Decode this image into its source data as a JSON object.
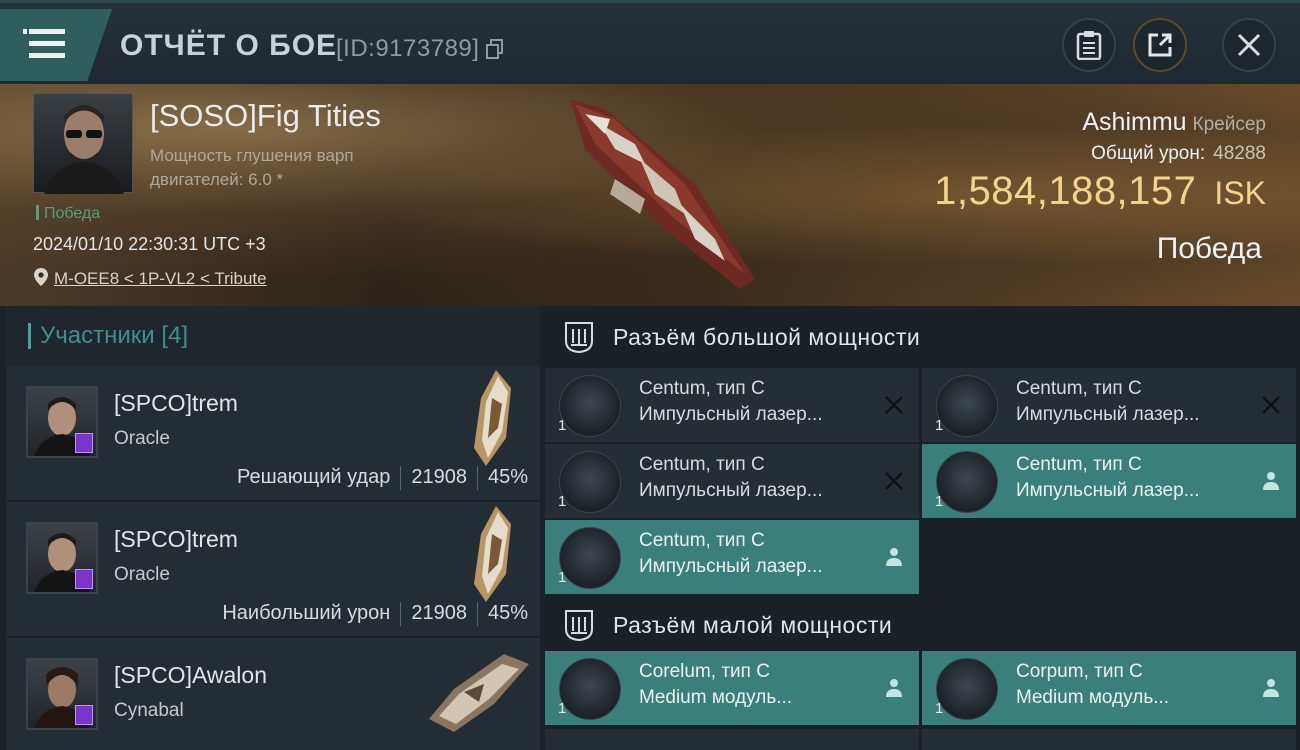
{
  "header": {
    "title": "ОТЧЁТ О БОЕ",
    "report_id": "[ID:9173789]"
  },
  "victim": {
    "name": "[SOSO]Fig Tities",
    "attribute": "Мощность глушения варп двигателей: 6.0 *",
    "result_tag": "Победа",
    "datetime": "2024/01/10 22:30:31 UTC +3",
    "location": "M-OEE8 < 1P-VL2 < Tribute",
    "ship_name": "Ashimmu",
    "ship_class": "Крейсер",
    "total_damage_label": "Общий урон:",
    "total_damage": "48288",
    "isk_value": "1,584,188,157",
    "isk_unit": "ISK",
    "result": "Победа"
  },
  "participants": {
    "label": "Участники",
    "count": "[4]",
    "rows": [
      {
        "name": "[SPCO]trem",
        "ship": "Oracle",
        "tag": "Решающий удар",
        "damage": "21908",
        "percent": "45%"
      },
      {
        "name": "[SPCO]trem",
        "ship": "Oracle",
        "tag": "Наибольший урон",
        "damage": "21908",
        "percent": "45%"
      },
      {
        "name": "[SPCO]Awalon",
        "ship": "Cynabal",
        "tag": "",
        "damage": "",
        "percent": ""
      }
    ]
  },
  "fitting": {
    "high_slot_label": "Разъём большой мощности",
    "low_slot_label": "Разъём малой мощности",
    "high_slots": [
      {
        "name": "Centum, тип C",
        "desc": "Импульсный лазер...",
        "qty": "1",
        "status": "destroyed"
      },
      {
        "name": "Centum, тип C",
        "desc": "Импульсный лазер...",
        "qty": "1",
        "status": "destroyed"
      },
      {
        "name": "Centum, тип C",
        "desc": "Импульсный лазер...",
        "qty": "1",
        "status": "destroyed"
      },
      {
        "name": "Centum, тип C",
        "desc": "Импульсный лазер...",
        "qty": "1",
        "status": "dropped"
      },
      {
        "name": "Centum, тип C",
        "desc": "Импульсный лазер...",
        "qty": "1",
        "status": "dropped"
      }
    ],
    "low_slots": [
      {
        "name": "Corelum, тип C",
        "desc": "Medium модуль...",
        "qty": "1",
        "status": "dropped"
      },
      {
        "name": "Corpum, тип C",
        "desc": "Medium модуль...",
        "qty": "1",
        "status": "dropped"
      }
    ]
  },
  "colors": {
    "accent": "#47a5a0",
    "dropped_bg": "#3a7f79",
    "isk": "#f3d48c",
    "victory": "#4fa37a"
  }
}
